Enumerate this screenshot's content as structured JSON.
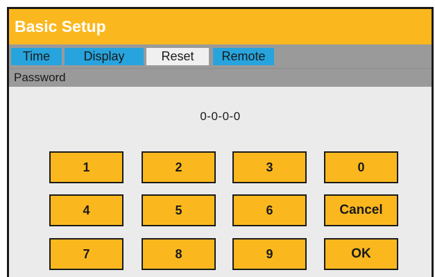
{
  "window": {
    "title": "Basic Setup"
  },
  "tabs": [
    {
      "label": "Time",
      "active": false
    },
    {
      "label": "Display",
      "active": false
    },
    {
      "label": "Reset",
      "active": true
    },
    {
      "label": "Remote",
      "active": false
    }
  ],
  "section": {
    "label": "Password"
  },
  "password": {
    "value": "0-0-0-0"
  },
  "keypad": {
    "keys": [
      "1",
      "2",
      "3",
      "0",
      "4",
      "5",
      "6",
      "Cancel",
      "7",
      "8",
      "9",
      "OK"
    ]
  },
  "colors": {
    "accent": "#fbb81e",
    "tab": "#27a4dd",
    "tab_active": "#f0f0f0",
    "bar": "#9a9a9a",
    "panel": "#ebebeb"
  }
}
